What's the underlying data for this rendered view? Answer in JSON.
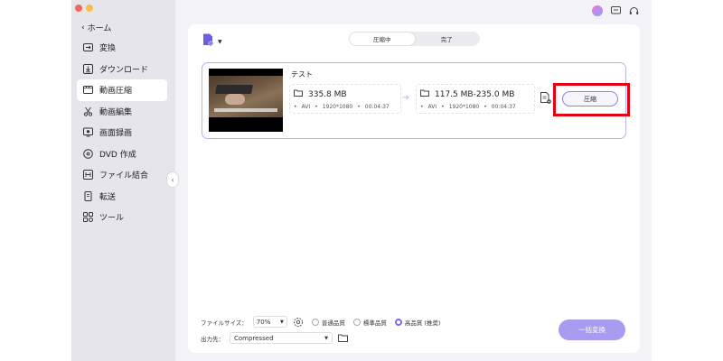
{
  "sidebar": {
    "back_label": "ホーム",
    "items": [
      {
        "label": "変換",
        "icon": "convert-icon"
      },
      {
        "label": "ダウンロード",
        "icon": "download-icon"
      },
      {
        "label": "動画圧縮",
        "icon": "compress-icon",
        "active": true
      },
      {
        "label": "動画編集",
        "icon": "scissors-icon"
      },
      {
        "label": "画面録画",
        "icon": "screen-record-icon"
      },
      {
        "label": "DVD 作成",
        "icon": "dvd-icon"
      },
      {
        "label": "ファイル結合",
        "icon": "merge-icon"
      },
      {
        "label": "転送",
        "icon": "transfer-icon"
      },
      {
        "label": "ツール",
        "icon": "toolbox-icon"
      }
    ]
  },
  "tabs": [
    {
      "label": "圧縮中",
      "active": true
    },
    {
      "label": "完了",
      "active": false
    }
  ],
  "file": {
    "title": "テスト",
    "source": {
      "size": "335.8 MB",
      "format": "AVI",
      "resolution": "1920*1080",
      "duration": "00:04:37"
    },
    "target": {
      "size": "117.5 MB-235.0 MB",
      "format": "AVI",
      "resolution": "1920*1080",
      "duration": "00:04:37"
    },
    "compress_label": "圧縮"
  },
  "bottom": {
    "filesize_label": "ファイルサイズ：",
    "filesize_value": "70%",
    "quality_options": [
      {
        "label": "普通品質",
        "checked": false
      },
      {
        "label": "標準品質",
        "checked": false
      },
      {
        "label": "高品質 (推奨)",
        "checked": true
      }
    ],
    "output_label": "出力先：",
    "output_value": "Compressed",
    "batch_label": "一括変換"
  },
  "colors": {
    "accent": "#7b6cf0",
    "highlight": "#e50012",
    "batch_button": "#a79cf0"
  }
}
